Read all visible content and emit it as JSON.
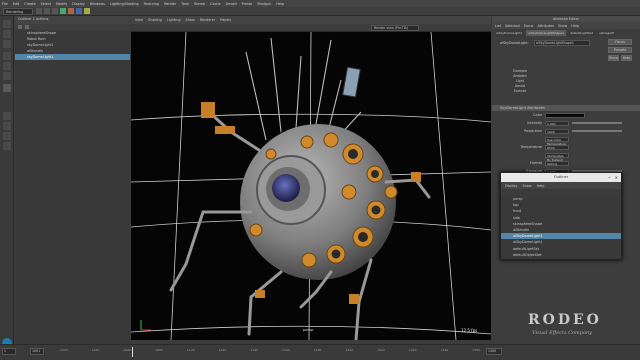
{
  "menubar": [
    "File",
    "Edit",
    "Create",
    "Select",
    "Modify",
    "Display",
    "Windows",
    "Lighting/Shading",
    "Texturing",
    "Render",
    "Toon",
    "Stereo",
    "Cache",
    "Arnold",
    "Presto",
    "Shotgun",
    "Help"
  ],
  "status": {
    "mode": "Rendering"
  },
  "outliner": {
    "title": "Outliner",
    "header": "Outliner 1 Actions",
    "items": [
      {
        "label": "skinsphereShape",
        "selected": false
      },
      {
        "label": "Robot Rom",
        "selected": false
      },
      {
        "label": "skyDomeLight1",
        "selected": false
      },
      {
        "label": "aiStandIn",
        "selected": false
      },
      {
        "label": "skyDomeLight1",
        "selected": true
      }
    ]
  },
  "viewport": {
    "menus": [
      "View",
      "Shading",
      "Lighting",
      "Show",
      "Renderer",
      "Panels"
    ],
    "renderer": "Render view (Pre-Tilt)",
    "camera": "persp",
    "fps": "12.5 fps",
    "colors": {
      "background": "#050505",
      "grid": "#cfcfcf",
      "body": "#8b8b8b",
      "rim": "#d08a2c",
      "eye": "#2a2f6e"
    }
  },
  "attribute_editor": {
    "title": "Attribute Editor",
    "tabs": [
      "List",
      "Selected",
      "Focus",
      "Attributes",
      "Show",
      "Help"
    ],
    "node_tabs": [
      "aiSkyDomeLight1",
      "aiSkyDomeLightShape1",
      "defaultLightSet",
      "aiImagerE"
    ],
    "node_label": "aiSkyDomeLight:",
    "node_value": "aiSkyDomeLightShape1",
    "buttons": [
      "Focus",
      "Presets",
      "Show",
      "Hide"
    ],
    "thumb_lines": [
      "Example",
      "Ambient",
      "Light",
      "Arnold",
      "Exclude"
    ],
    "section": "SkyDomeLight Attributes",
    "attrs": [
      {
        "label": "Color",
        "value": ""
      },
      {
        "label": "Intensity",
        "value": "1.000"
      },
      {
        "label": "Resolution",
        "value": "1000"
      },
      {
        "label": "",
        "value": "Use Color Temperature"
      },
      {
        "label": "Temperature",
        "value": "6500"
      },
      {
        "label": "",
        "value": "Illuminates By Default"
      },
      {
        "label": "Format",
        "value": "latlong"
      },
      {
        "label": "Exposure",
        "value": "0.000"
      },
      {
        "label": "Samples",
        "value": "1"
      }
    ]
  },
  "popup_outliner": {
    "title": "Outliner",
    "menus": [
      "Display",
      "Show",
      "Help"
    ],
    "items": [
      {
        "label": "persp",
        "selected": false
      },
      {
        "label": "top",
        "selected": false
      },
      {
        "label": "front",
        "selected": false
      },
      {
        "label": "side",
        "selected": false
      },
      {
        "label": "skinsphereShape",
        "selected": false
      },
      {
        "label": "aiStandIn",
        "selected": false
      },
      {
        "label": "aiSkyDomeLight1",
        "selected": true
      },
      {
        "label": "aiSkyDomeLight1",
        "selected": false
      },
      {
        "label": "defaultLightSet",
        "selected": false
      },
      {
        "label": "defaultObjectSet",
        "selected": false
      }
    ]
  },
  "timeline": {
    "start": "1",
    "start_field": "1001",
    "ticks": [
      "1020",
      "1040",
      "1060",
      "1080",
      "1100",
      "1120",
      "1140",
      "1160",
      "1180",
      "1200",
      "1220",
      "1240",
      "1260",
      "1280"
    ],
    "end": "1300"
  },
  "watermark": {
    "brand": "RODEO",
    "tagline": "Visual Effects Company"
  }
}
